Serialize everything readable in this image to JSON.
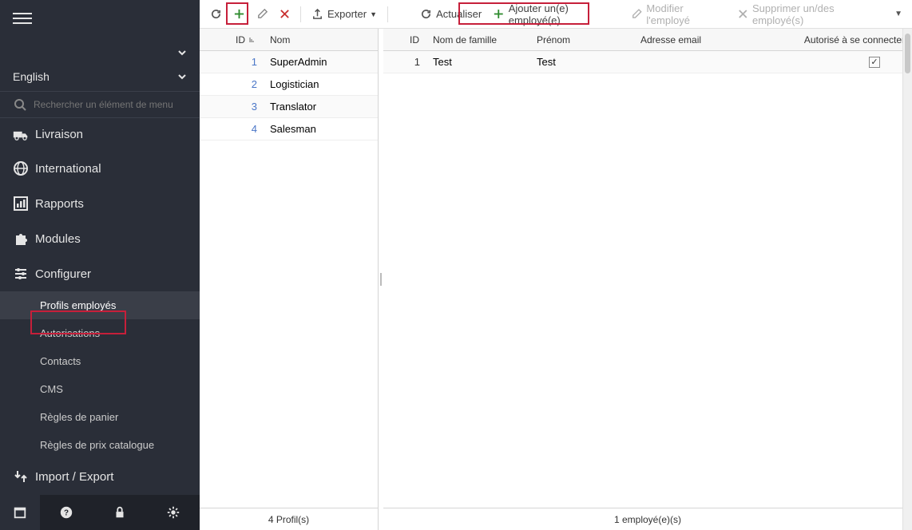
{
  "sidebar": {
    "language": "English",
    "search_placeholder": "Rechercher un élément de menu",
    "nav": {
      "livraison": "Livraison",
      "international": "International",
      "rapports": "Rapports",
      "modules": "Modules",
      "configurer": "Configurer",
      "import_export": "Import / Export"
    },
    "config_sub": {
      "profils": "Profils employés",
      "autorisations": "Autorisations",
      "contacts": "Contacts",
      "cms": "CMS",
      "regles_panier": "Règles de panier",
      "regles_prix": "Règles de prix catalogue"
    }
  },
  "toolbar_left": {
    "exporter": "Exporter"
  },
  "toolbar_right": {
    "actualiser": "Actualiser",
    "ajouter": "Ajouter un(e) employé(e)",
    "modifier": "Modifier l'employé",
    "supprimer": "Supprimer un/des employé(s)"
  },
  "left_grid": {
    "headers": {
      "id": "ID",
      "nom": "Nom"
    },
    "rows": [
      {
        "id": "1",
        "nom": "SuperAdmin"
      },
      {
        "id": "2",
        "nom": "Logistician"
      },
      {
        "id": "3",
        "nom": "Translator"
      },
      {
        "id": "4",
        "nom": "Salesman"
      }
    ],
    "footer": "4 Profil(s)"
  },
  "right_grid": {
    "headers": {
      "id": "ID",
      "nom": "Nom de famille",
      "prenom": "Prénom",
      "email": "Adresse email",
      "auth": "Autorisé à se connecter"
    },
    "rows": [
      {
        "id": "1",
        "nom": "Test",
        "prenom": "Test",
        "email": "",
        "auth": true
      }
    ],
    "footer": "1 employé(e)(s)"
  }
}
